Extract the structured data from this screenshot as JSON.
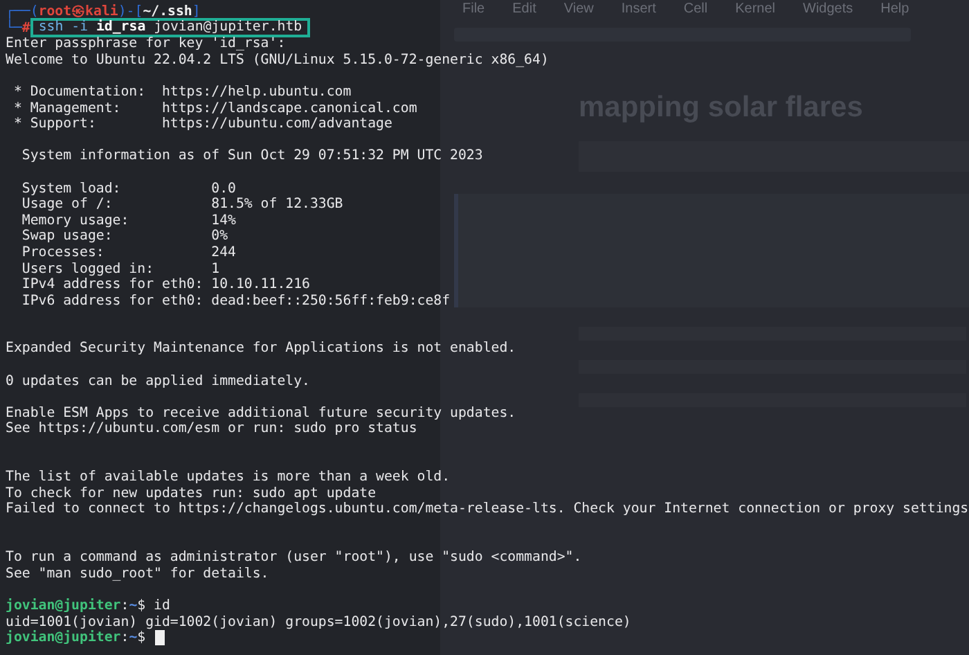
{
  "notebook": {
    "menu": [
      "File",
      "Edit",
      "View",
      "Insert",
      "Cell",
      "Kernel",
      "Widgets",
      "Help"
    ],
    "heading": "mapping solar flares"
  },
  "terminal": {
    "lines": [
      {
        "kind": "prompt-top",
        "parts": [
          {
            "kind": "frame",
            "text": "┌──("
          },
          {
            "kind": "user",
            "text": "root㉿kali"
          },
          {
            "kind": "frame",
            "text": ")-["
          },
          {
            "kind": "path",
            "text": "~/.ssh"
          },
          {
            "kind": "frame",
            "text": "]"
          }
        ]
      },
      {
        "kind": "prompt-bottom",
        "symbol": "└─",
        "marker": "#",
        "highlighted": true,
        "parts": [
          {
            "kind": "command",
            "text": "ssh -i"
          },
          {
            "kind": "bold",
            "text": "id_rsa"
          },
          {
            "kind": "plain",
            "text": "jovian@jupiter.htb"
          }
        ]
      },
      {
        "kind": "text",
        "text": "Enter passphrase for key 'id_rsa':"
      },
      {
        "kind": "text",
        "text": "Welcome to Ubuntu 22.04.2 LTS (GNU/Linux 5.15.0-72-generic x86_64)"
      },
      {
        "kind": "blank"
      },
      {
        "kind": "text",
        "text": " * Documentation:  https://help.ubuntu.com"
      },
      {
        "kind": "text",
        "text": " * Management:     https://landscape.canonical.com"
      },
      {
        "kind": "text",
        "text": " * Support:        https://ubuntu.com/advantage"
      },
      {
        "kind": "blank"
      },
      {
        "kind": "text",
        "text": "  System information as of Sun Oct 29 07:51:32 PM UTC 2023"
      },
      {
        "kind": "blank"
      },
      {
        "kind": "text",
        "text": "  System load:           0.0"
      },
      {
        "kind": "text",
        "text": "  Usage of /:            81.5% of 12.33GB"
      },
      {
        "kind": "text",
        "text": "  Memory usage:          14%"
      },
      {
        "kind": "text",
        "text": "  Swap usage:            0%"
      },
      {
        "kind": "text",
        "text": "  Processes:             244"
      },
      {
        "kind": "text",
        "text": "  Users logged in:       1"
      },
      {
        "kind": "text",
        "text": "  IPv4 address for eth0: 10.10.11.216"
      },
      {
        "kind": "text",
        "text": "  IPv6 address for eth0: dead:beef::250:56ff:feb9:ce8f"
      },
      {
        "kind": "blank"
      },
      {
        "kind": "blank"
      },
      {
        "kind": "text",
        "text": "Expanded Security Maintenance for Applications is not enabled."
      },
      {
        "kind": "blank"
      },
      {
        "kind": "text",
        "text": "0 updates can be applied immediately."
      },
      {
        "kind": "blank"
      },
      {
        "kind": "text",
        "text": "Enable ESM Apps to receive additional future security updates."
      },
      {
        "kind": "text",
        "text": "See https://ubuntu.com/esm or run: sudo pro status"
      },
      {
        "kind": "blank"
      },
      {
        "kind": "blank"
      },
      {
        "kind": "text",
        "text": "The list of available updates is more than a week old."
      },
      {
        "kind": "text",
        "text": "To check for new updates run: sudo apt update"
      },
      {
        "kind": "text",
        "text": "Failed to connect to https://changelogs.ubuntu.com/meta-release-lts. Check your Internet connection or proxy settings"
      },
      {
        "kind": "blank"
      },
      {
        "kind": "blank"
      },
      {
        "kind": "text",
        "text": "To run a command as administrator (user \"root\"), use \"sudo <command>\"."
      },
      {
        "kind": "text",
        "text": "See \"man sudo_root\" for details."
      },
      {
        "kind": "blank"
      },
      {
        "kind": "user-prompt",
        "user": "jovian@jupiter",
        "separator": ":",
        "path": "~",
        "marker": "$",
        "command": "id",
        "cursor": false
      },
      {
        "kind": "text",
        "text": "uid=1001(jovian) gid=1002(jovian) groups=1002(jovian),27(sudo),1001(science)"
      },
      {
        "kind": "user-prompt",
        "user": "jovian@jupiter",
        "separator": ":",
        "path": "~",
        "marker": "$",
        "cursor": true
      }
    ]
  }
}
